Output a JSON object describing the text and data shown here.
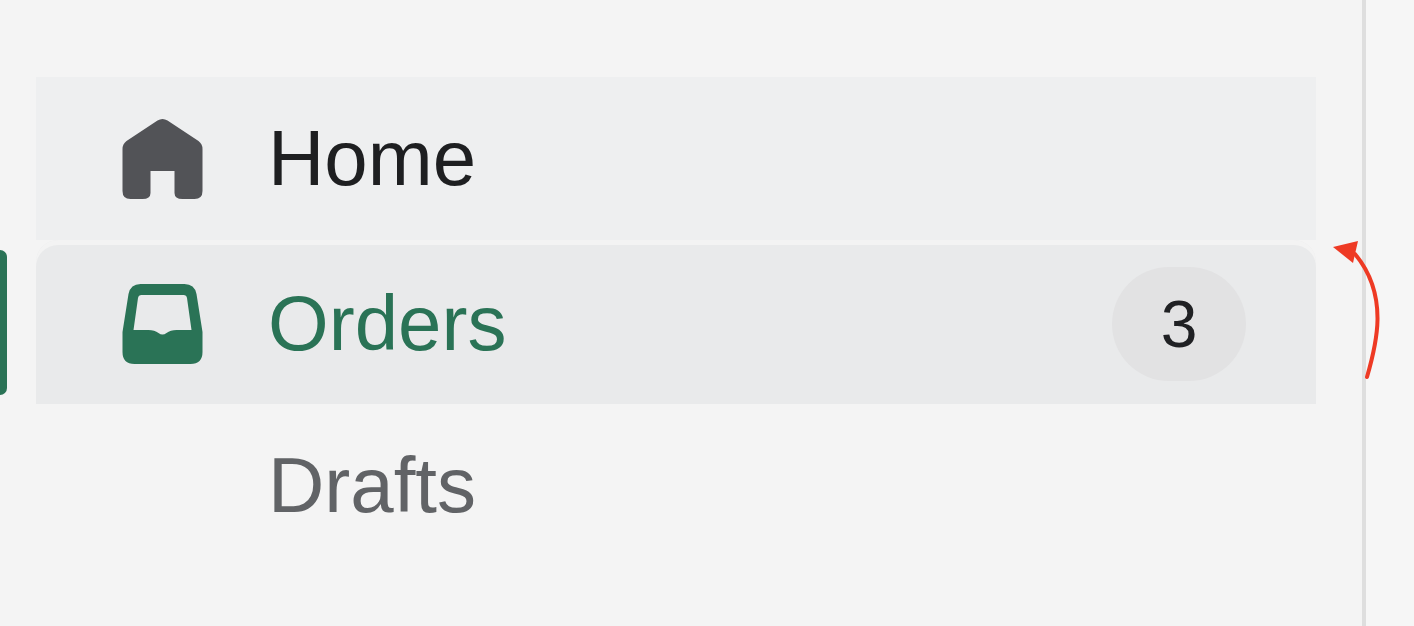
{
  "sidebar": {
    "items": [
      {
        "label": "Home",
        "kind": "item",
        "selected": false
      },
      {
        "label": "Orders",
        "kind": "item",
        "selected": true,
        "badge": "3"
      },
      {
        "label": "Drafts",
        "kind": "subitem",
        "selected": false
      }
    ]
  }
}
